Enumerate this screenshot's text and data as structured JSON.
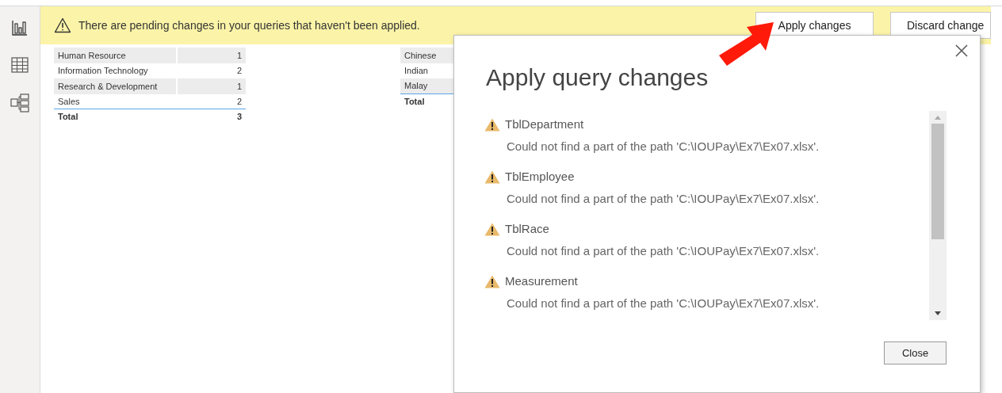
{
  "banner": {
    "message": "There are pending changes in your queries that haven't been applied.",
    "buttons": [
      "Apply changes",
      "Discard change"
    ]
  },
  "tables": [
    {
      "rows": [
        {
          "label": "Human Resource",
          "value": "1"
        },
        {
          "label": "Information Technology",
          "value": "2"
        },
        {
          "label": "Research & Development",
          "value": "1"
        },
        {
          "label": "Sales",
          "value": "2"
        }
      ],
      "total": {
        "label": "Total",
        "value": "3"
      }
    },
    {
      "rows": [
        {
          "label": "Chinese"
        },
        {
          "label": "Indian"
        },
        {
          "label": "Malay"
        }
      ],
      "total": {
        "label": "Total"
      }
    }
  ],
  "dialog": {
    "title": "Apply query changes",
    "items": [
      {
        "name": "TblDepartment",
        "message": "Could not find a part of the path 'C:\\IOUPay\\Ex7\\Ex07.xlsx'."
      },
      {
        "name": "TblEmployee",
        "message": "Could not find a part of the path 'C:\\IOUPay\\Ex7\\Ex07.xlsx'."
      },
      {
        "name": "TblRace",
        "message": "Could not find a part of the path 'C:\\IOUPay\\Ex7\\Ex07.xlsx'."
      },
      {
        "name": "Measurement",
        "message": "Could not find a part of the path 'C:\\IOUPay\\Ex7\\Ex07.xlsx'."
      }
    ],
    "close_button": "Close"
  }
}
